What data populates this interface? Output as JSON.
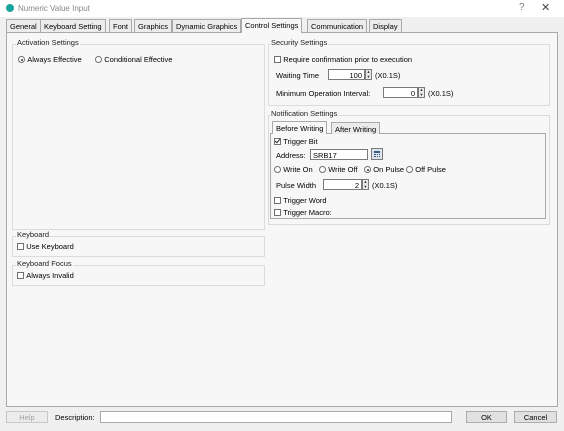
{
  "window": {
    "title": "Numeric Value Input"
  },
  "titlebar": {
    "help": "?",
    "close": "✕"
  },
  "tabs": [
    {
      "label": "General"
    },
    {
      "label": "Keyboard Setting"
    },
    {
      "label": "Font"
    },
    {
      "label": "Graphics"
    },
    {
      "label": "Dynamic Graphics"
    },
    {
      "label": "Control Settings"
    },
    {
      "label": "Communication"
    },
    {
      "label": "Display"
    }
  ],
  "activation": {
    "title": "Activation Settings",
    "always": "Always Effective",
    "conditional": "Conditional Effective",
    "selected": "always"
  },
  "security": {
    "title": "Security Settings",
    "require_label": "Require confirmation prior to execution",
    "waiting_label": "Waiting Time",
    "waiting_value": "100",
    "waiting_unit": "(X0.1S)",
    "min_label": "Minimum Operation Interval:",
    "min_value": "0",
    "min_unit": "(X0.1S)"
  },
  "notification": {
    "title": "Notification Settings",
    "tabs": [
      {
        "label": "Before Writing"
      },
      {
        "label": "After Writing"
      }
    ],
    "trigger_bit": "Trigger Bit",
    "address_label": "Address:",
    "address_value": "SRB17",
    "write_on": "Write On",
    "write_off": "Write Off",
    "on_pulse": "On Pulse",
    "off_pulse": "Off Pulse",
    "pulse_label": "Pulse Width",
    "pulse_value": "2",
    "pulse_unit": "(X0.1S)",
    "trigger_word": "Trigger Word",
    "trigger_macro": "Trigger Macro:"
  },
  "keyboard": {
    "title": "Keyboard",
    "use": "Use Keyboard"
  },
  "focus": {
    "title": "Keyboard Focus",
    "always_invalid": "Always Invalid"
  },
  "bottom": {
    "help": "Help",
    "description": "Description:",
    "ok": "OK",
    "cancel": "Cancel"
  }
}
